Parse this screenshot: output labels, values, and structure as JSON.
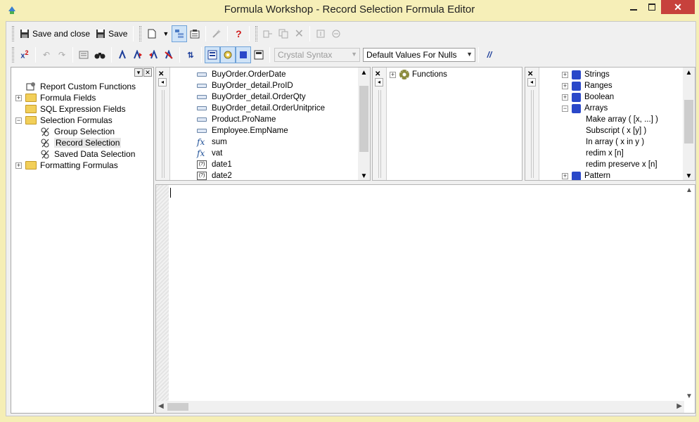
{
  "window": {
    "title": "Formula Workshop - Record Selection Formula Editor"
  },
  "toolbar1": {
    "save_close_label": "Save and close",
    "save_label": "Save"
  },
  "toolbar2": {
    "syntax_combo": "Crystal Syntax",
    "nulls_combo": "Default Values For Nulls",
    "comment_label": "//"
  },
  "workshop_tree": {
    "items": [
      {
        "label": "Report Custom Functions"
      },
      {
        "label": "Formula Fields"
      },
      {
        "label": "SQL Expression Fields"
      },
      {
        "label": "Selection Formulas"
      },
      {
        "label": "Group Selection"
      },
      {
        "label": "Record Selection"
      },
      {
        "label": "Saved Data Selection"
      },
      {
        "label": "Formatting Formulas"
      }
    ]
  },
  "fields_list": {
    "items": [
      {
        "label": "BuyOrder.OrderDate",
        "icon": "field-icon"
      },
      {
        "label": "BuyOrder_detail.ProID",
        "icon": "field-icon"
      },
      {
        "label": "BuyOrder_detail.OrderQty",
        "icon": "field-icon"
      },
      {
        "label": "BuyOrder_detail.OrderUnitprice",
        "icon": "field-icon"
      },
      {
        "label": "Product.ProName",
        "icon": "field-icon"
      },
      {
        "label": "Employee.EmpName",
        "icon": "field-icon"
      },
      {
        "label": "sum",
        "icon": "formula-icon"
      },
      {
        "label": "vat",
        "icon": "formula-icon"
      },
      {
        "label": "date1",
        "icon": "parameter-icon"
      },
      {
        "label": "date2",
        "icon": "parameter-icon"
      }
    ],
    "fx_glyph": "fx",
    "param_glyph": "(?)"
  },
  "functions_list": {
    "items": [
      {
        "label": "Functions"
      }
    ]
  },
  "operators_list": {
    "items": [
      {
        "label": "Strings"
      },
      {
        "label": "Ranges"
      },
      {
        "label": "Boolean"
      },
      {
        "label": "Arrays"
      },
      {
        "label": "Make array ( [x, ...] )"
      },
      {
        "label": "Subscript ( x [y] )"
      },
      {
        "label": "In array ( x in y )"
      },
      {
        "label": "redim x [n]"
      },
      {
        "label": "redim preserve x [n]"
      },
      {
        "label": "Pattern"
      }
    ]
  }
}
